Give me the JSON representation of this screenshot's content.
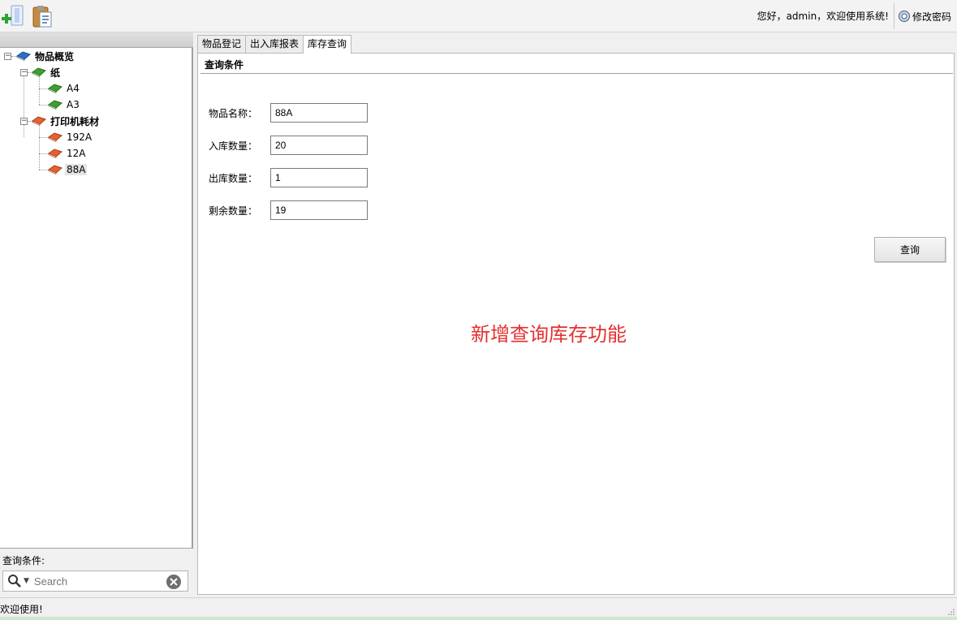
{
  "toolbar": {
    "add_icon": "add-item-icon",
    "paste_icon": "clipboard-icon",
    "greeting": "您好，admin，欢迎使用系统!",
    "change_password": "修改密码"
  },
  "tree": {
    "root": "物品概览",
    "categories": [
      {
        "label": "纸",
        "color": "#3aa12e",
        "items": [
          "A4",
          "A3"
        ]
      },
      {
        "label": "打印机耗材",
        "color": "#e8602e",
        "items": [
          "192A",
          "12A",
          "88A"
        ]
      }
    ],
    "selected": "88A"
  },
  "search": {
    "label": "查询条件:",
    "placeholder": "Search"
  },
  "tabs": [
    {
      "label": "物品登记",
      "active": false
    },
    {
      "label": "出入库报表",
      "active": false
    },
    {
      "label": "库存查询",
      "active": true
    }
  ],
  "query": {
    "section_title": "查询条件",
    "fields": [
      {
        "label": "物品名称：",
        "value": "88A"
      },
      {
        "label": "入库数量：",
        "value": "20"
      },
      {
        "label": "出库数量：",
        "value": "1"
      },
      {
        "label": "剩余数量：",
        "value": "19"
      }
    ],
    "button": "查询"
  },
  "notice": "新增查询库存功能",
  "status": "欢迎使用!",
  "colors": {
    "notice": "#e53030",
    "root_book": "#2a6fc4"
  }
}
